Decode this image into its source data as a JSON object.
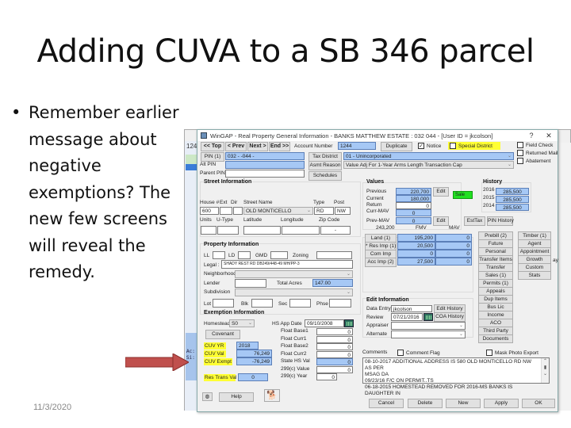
{
  "slide": {
    "title": "Adding CUVA to a SB 346 parcel",
    "bullet": "Remember earlier message about negative exemptions? The new few screens will reveal the remedy.",
    "bullet_glyph": "•",
    "date": "11/3/2020",
    "arrow_color": "#c0504d"
  },
  "background_window": {
    "account_fragment": "124",
    "mono_lines": [
      "Ac:",
      "Si:"
    ]
  },
  "dialog": {
    "title": "WinGAP - Real Property General Information - BANKS MATTHEW ESTATE : 032   044        - [User ID = jkcolson]",
    "help_glyph": "?",
    "close_glyph": "✕",
    "nav": {
      "top": "<< Top",
      "prev": "< Prev",
      "next": "Next >",
      "end": "End >>"
    },
    "account_label": "Account Number",
    "account_number": "1244",
    "duplicate": "Duplicate",
    "notice": {
      "label": "Notice",
      "checked": true
    },
    "special_district": {
      "label": "Special District",
      "checked": false
    },
    "field_check": "Field Check",
    "returned_mail": "Returned Mail",
    "abatement": "Abatement",
    "pin_button": "PIN (1)",
    "pin_value": "032 -  -044 -",
    "alt_pin_label": "Alt PIN",
    "alt_pin_value": "",
    "parent_pin_label": "Parent PIN",
    "parent_pin_value": "",
    "tax_district_btn": "Tax District",
    "tax_district_value": "01 - Unincorporated",
    "asmt_reason_btn": "Asmt Reason",
    "asmt_reason_value": "Value Adj For 1-Year Arms Length Transaction Cap",
    "schedules_btn": "Schedules",
    "street": {
      "header": "Street Information",
      "labels": {
        "house": "House #",
        "ext": "Ext",
        "dir": "Dir",
        "street": "Street Name",
        "type": "Type",
        "post": "Post",
        "units": "Units",
        "utype": "U-Type",
        "lat": "Latitude",
        "lon": "Longitude",
        "zip": "Zip Code"
      },
      "house": "600",
      "ext": "",
      "dir": "",
      "street": "OLD MONTICELLO",
      "type": "RD",
      "post": "NW",
      "units": "",
      "utype": "",
      "lat": "",
      "lon": "",
      "zip": "-"
    },
    "values": {
      "header": "Values",
      "previous_label": "Previous",
      "previous": "220,700",
      "current_label": "Current",
      "current": "180,000",
      "return_label": "Return",
      "return": "0",
      "curr_mav_label": "Curr-MAV",
      "curr_mav": "0",
      "prev_mav_label": "Prev-MAV",
      "prev_mav": "0",
      "edit1": "Edit",
      "edit2": "Edit",
      "sale_badge": "Sale",
      "esttax": "EstTax",
      "pin_history": "PIN History"
    },
    "history": {
      "header": "History",
      "rows": [
        {
          "year": "2016",
          "value": "285,500"
        },
        {
          "year": "2015",
          "value": "285,500"
        },
        {
          "year": "2014",
          "value": "285,500"
        }
      ]
    },
    "property": {
      "header": "Property Information",
      "ll_label": "LL",
      "ld_label": "LD",
      "gmd_label": "GMD",
      "zoning_label": "Zoning",
      "ll": "",
      "ld": "",
      "gmd": "",
      "zoning": "",
      "legal_label": "Legal :",
      "legal": "SHADY REST RD DB249/448-49 MH/PP-3",
      "neighborhood_label": "Neighborhood",
      "neighborhood": "",
      "lender_label": "Lender",
      "lender": "",
      "total_acres_label": "Total Acres",
      "total_acres": "147.00",
      "subdivision_label": "Subdivision",
      "subdivision": "",
      "lot_label": "Lot",
      "blk_label": "Blk",
      "sec_label": "Sec",
      "phse_label": "Phse",
      "lot": "",
      "blk": "",
      "sec": "",
      "phse": ""
    },
    "fmv": {
      "total": "243,200",
      "fmv_header": "FMV",
      "mav_header": "MAV",
      "rows": [
        {
          "label": "Land (1)",
          "fmv": "195,200",
          "mav": "0"
        },
        {
          "label": "* Res Imp (1)",
          "fmv": "20,500",
          "mav": "0"
        },
        {
          "label": "Com Imp",
          "fmv": "0",
          "mav": "0"
        },
        {
          "label": "Acc Imp (2)",
          "fmv": "27,500",
          "mav": "0"
        }
      ]
    },
    "side_buttons_col1": [
      "Prebill (2)",
      "Future",
      "Personal",
      "Transfer Items",
      "Transfer",
      "Sales (1)",
      "Permits (1)",
      "Appeals",
      "Dup Items",
      "Bus Lic",
      "Income",
      "ACO",
      "Third Party",
      "Documents"
    ],
    "side_buttons_col2": [
      "Timber (1)",
      "Agent",
      "Appointment",
      "Growth",
      "Custom Flags",
      "Stats"
    ],
    "bg_label_fragment": "ay",
    "edit_info": {
      "header": "Edit Information",
      "data_entry_label": "Data Entry",
      "data_entry": "jkcolson",
      "review_label": "Review",
      "review": "07/21/2016",
      "appraiser_label": "Appraiser",
      "appraiser": "",
      "alternate_label": "Alternate",
      "alternate": "",
      "edit_history": "Edit History",
      "coa_history": "COA History"
    },
    "exemption": {
      "header": "Exemption Information",
      "homestead_label": "Homestead",
      "homestead": "S0",
      "hs_app_date_label": "HS App Date",
      "hs_app_date": "09/10/2008",
      "covenant": "Covenant",
      "cuv_yr_label": "CUV YR",
      "cuv_yr": "2018",
      "cuv_val_label": "CUV Val",
      "cuv_val": "76,249",
      "cuv_exmpt_label": "CUV Exmpt",
      "cuv_exmpt": "-76,249",
      "res_trans_label": "Res Trans Val",
      "res_trans": "0",
      "floats": [
        {
          "label": "Float Base1",
          "value": "0"
        },
        {
          "label": "Float Curr1",
          "value": "0"
        },
        {
          "label": "Float Base2",
          "value": "0"
        },
        {
          "label": "Float Curr2",
          "value": "0"
        },
        {
          "label": "State HS Val",
          "value": "0"
        },
        {
          "label": "299(c) Value",
          "value": "0"
        },
        {
          "label": "299(c) Year",
          "value": "0"
        }
      ]
    },
    "comments": {
      "label": "Comments",
      "comment_flag": "Comment Flag",
      "mask_photo": "Mask Photo Export",
      "lines": [
        "08-10-2017 ADDITIONAL ADDRESS IS 580 OLD MONTICELLO RD NW AS PER",
        "MSAG DA",
        "09/23/16 F/C ON PERMIT..TS",
        "06-18-2015 HOMESTEAD REMOVED FOR 2016-MS BANKS IS DAUGHTER IN"
      ]
    },
    "footer": {
      "help": "Help",
      "cancel": "Cancel",
      "delete": "Delete",
      "new": "New",
      "apply": "Apply",
      "ok": "OK"
    }
  }
}
